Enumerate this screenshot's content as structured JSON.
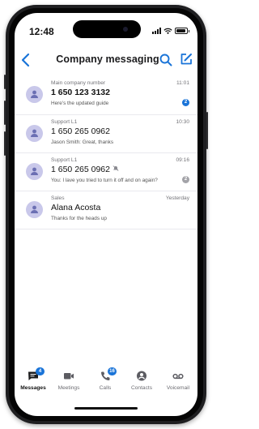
{
  "status": {
    "time": "12:48"
  },
  "nav": {
    "title": "Company messaging"
  },
  "conversations": [
    {
      "subtitle": "Main company number",
      "title": "1 650 123 3132",
      "bold": true,
      "preview": "Here's the updated guide",
      "time": "11:01",
      "badge": "2",
      "badge_color": "#1a74d8",
      "muted": false
    },
    {
      "subtitle": "Support L1",
      "title": "1 650 265 0962",
      "bold": false,
      "preview": "Jason Smith: Great, thanks",
      "time": "10:30",
      "badge": "",
      "muted": false
    },
    {
      "subtitle": "Support L1",
      "title": "1 650 265 0962",
      "bold": false,
      "preview": "You: I lave you tried to turn it off and on again?",
      "time": "09:16",
      "badge": "2",
      "badge_color": "#a3a3a8",
      "muted": true
    },
    {
      "subtitle": "Sales",
      "title": "Alana Acosta",
      "bold": false,
      "preview": "Thanks for the heads up",
      "time": "Yesterday",
      "badge": "",
      "muted": false
    }
  ],
  "tabs": [
    {
      "label": "Messages",
      "icon": "messages-icon",
      "active": true,
      "badge": "4"
    },
    {
      "label": "Meetings",
      "icon": "video-icon",
      "active": false,
      "badge": ""
    },
    {
      "label": "Calls",
      "icon": "phone-icon",
      "active": false,
      "badge": "16"
    },
    {
      "label": "Contacts",
      "icon": "contact-icon",
      "active": false,
      "badge": ""
    },
    {
      "label": "Voicemail",
      "icon": "voicemail-icon",
      "active": false,
      "badge": ""
    }
  ],
  "colors": {
    "accent": "#1a74d8",
    "avatar": "#c9c8ea"
  }
}
